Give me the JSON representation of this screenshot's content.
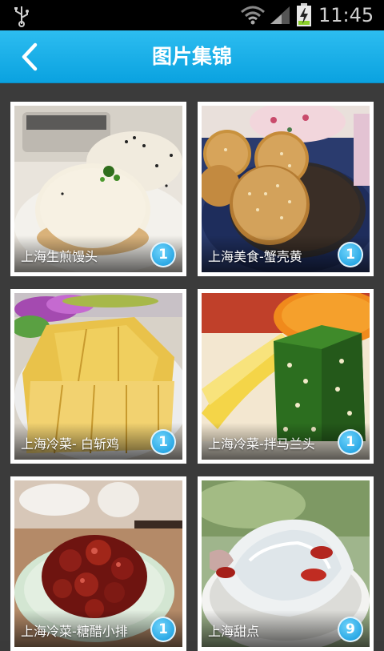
{
  "status_bar": {
    "time": "11:45",
    "icons": [
      "usb-icon",
      "wifi-icon",
      "signal-icon",
      "battery-charging-icon"
    ]
  },
  "header": {
    "title": "图片集锦",
    "back_icon": "chevron-left-icon",
    "background": "#1ab0ea"
  },
  "gallery": {
    "items": [
      {
        "label": "上海生煎馒头",
        "count": "1"
      },
      {
        "label": "上海美食-蟹壳黄",
        "count": "1"
      },
      {
        "label": "上海冷菜- 白斩鸡",
        "count": "1"
      },
      {
        "label": "上海冷菜-拌马兰头",
        "count": "1"
      },
      {
        "label": "上海冷菜-糖醋小排",
        "count": "1"
      },
      {
        "label": "上海甜点",
        "count": "9"
      }
    ]
  },
  "colors": {
    "accent": "#1ab0ea",
    "badge": "#1a9fe0",
    "page_background": "#3b3b3b"
  }
}
